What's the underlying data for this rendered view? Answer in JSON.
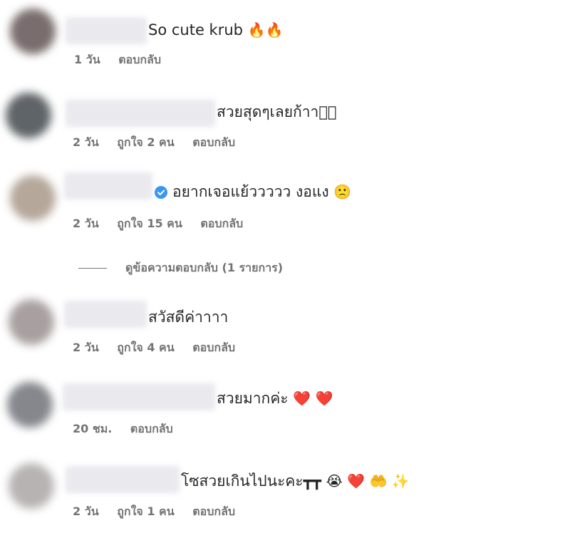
{
  "comments": [
    {
      "text": "So cute krub",
      "emoji": "🔥🔥",
      "time": "1 วัน",
      "likes": "",
      "reply_label": "ตอบกลับ",
      "avatar_color": "#7a6d6e",
      "verified": false
    },
    {
      "text": "สวยสุดๆเลยก้าา",
      "emoji": "􀀀􀀀",
      "time": "2 วัน",
      "likes": "ถูกใจ 2 คน",
      "reply_label": "ตอบกลับ",
      "avatar_color": "#5f6468",
      "verified": false
    },
    {
      "text": "อยากเจอแย้ววววว งอแง",
      "emoji": "🙁",
      "time": "2 วัน",
      "likes": "ถูกใจ 15 คน",
      "reply_label": "ตอบกลับ",
      "avatar_color": "#b5a79a",
      "verified": true
    },
    {
      "text": "สวัสดีค่าาาา",
      "emoji": "",
      "time": "2 วัน",
      "likes": "ถูกใจ 4 คน",
      "reply_label": "ตอบกลับ",
      "avatar_color": "#a8a0a0",
      "verified": false
    },
    {
      "text": "สวยมากค่ะ",
      "emoji": "❤️ ❤️",
      "time": "20 ชม.",
      "likes": "",
      "reply_label": "ตอบกลับ",
      "avatar_color": "#85878d",
      "verified": false
    },
    {
      "text": "โซสวยเกินไปนะคะ┳┳",
      "emoji": "😭 ❤️ 🤲 ✨",
      "time": "2 วัน",
      "likes": "ถูกใจ 1 คน",
      "reply_label": "ตอบกลับ",
      "avatar_color": "#b7b3b3",
      "verified": false
    }
  ],
  "view_replies_label": "ดูข้อความตอบกลับ (1 รายการ)",
  "colors": {
    "text": "#262626",
    "meta": "#737373",
    "verified_blue": "#3897f0"
  }
}
